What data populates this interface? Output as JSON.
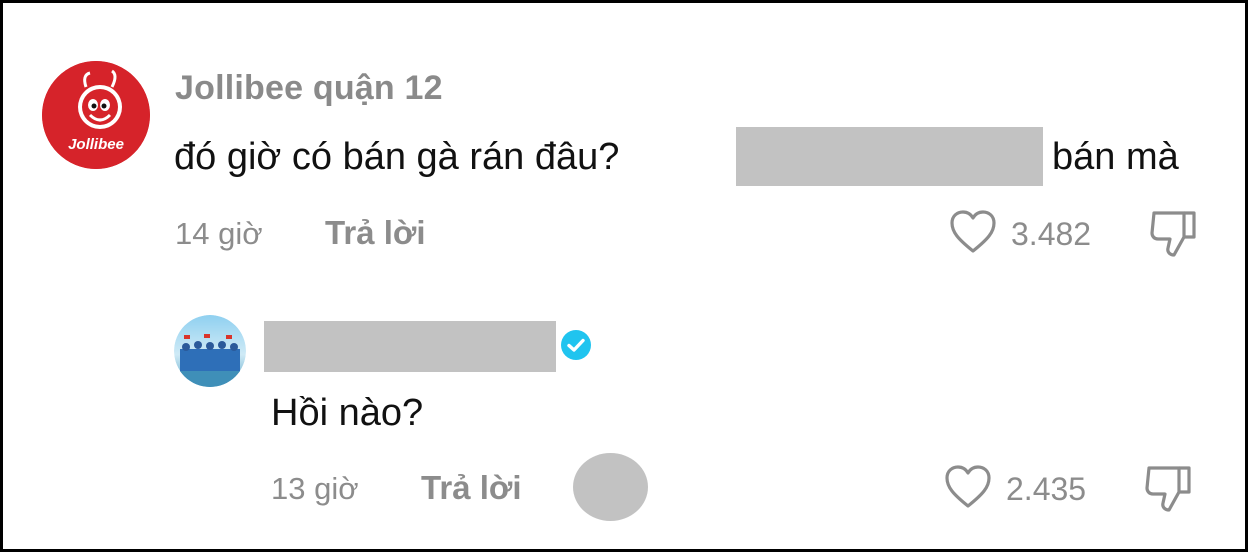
{
  "comment": {
    "author": "Jollibee quận 12",
    "avatar_logo_text": "Jollibee",
    "text_before": "đó giờ có bán gà rán đâu?",
    "text_after": "bán mà",
    "time": "14 giờ",
    "reply_label": "Trả lời",
    "likes": "3.482"
  },
  "reply": {
    "text": "Hồi nào?",
    "time": "13 giờ",
    "reply_label": "Trả lời",
    "likes": "2.435"
  },
  "colors": {
    "brand_red": "#d6232a",
    "verified_blue": "#20c4ef",
    "muted_text": "#8c8c8c",
    "redaction": "#c2c2c2"
  },
  "icons": [
    "heart-icon",
    "dislike-icon",
    "verified-badge-icon"
  ]
}
